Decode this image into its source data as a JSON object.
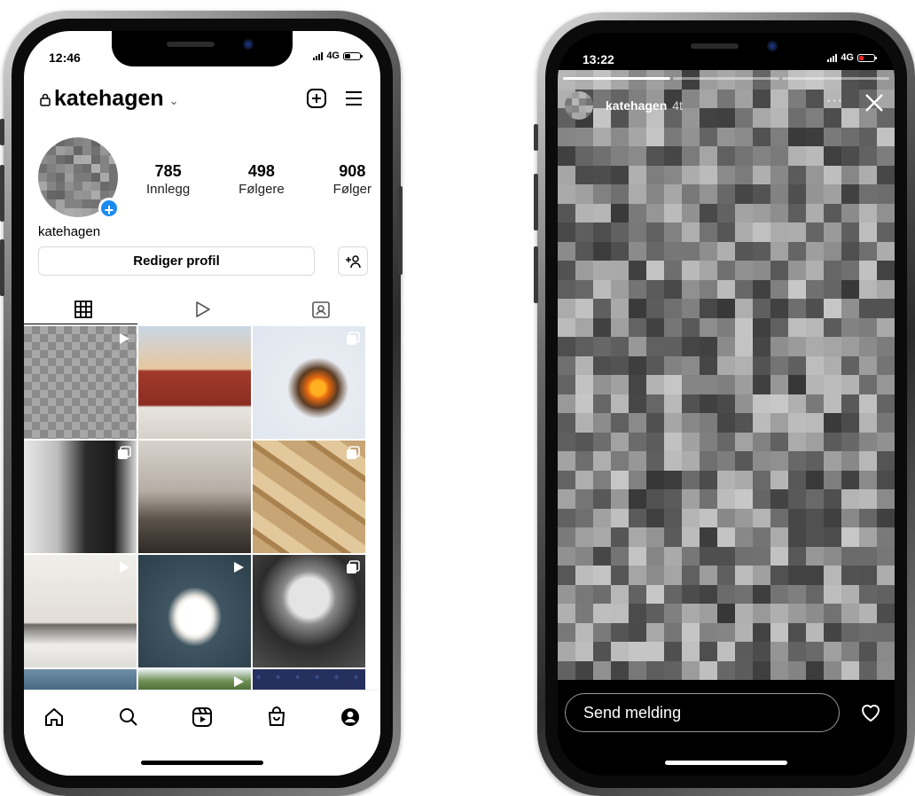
{
  "left_phone": {
    "status": {
      "time": "12:46",
      "network": "4G",
      "battery_color": "#000000"
    },
    "header": {
      "username": "katehagen",
      "lock_icon": "lock-icon",
      "chevron_icon": "chevron-down-icon",
      "chevron_glyph": "⌄",
      "new_post_icon": "plus-square-icon",
      "menu_icon": "hamburger-menu-icon"
    },
    "profile": {
      "stats": [
        {
          "number": "785",
          "label": "Innlegg"
        },
        {
          "number": "498",
          "label": "Følgere"
        },
        {
          "number": "908",
          "label": "Følger"
        }
      ],
      "display_name": "katehagen",
      "add_story_glyph": "+",
      "edit_button": "Rediger profil",
      "discover_people_icon": "add-user-icon"
    },
    "tabs": [
      {
        "icon": "grid-icon",
        "selected": true
      },
      {
        "icon": "reels-icon",
        "selected": false
      },
      {
        "icon": "tagged-icon",
        "selected": false
      }
    ],
    "grid": [
      {
        "desc": "blurred-image",
        "overlay": "reel-icon"
      },
      {
        "desc": "rooftop-sunset",
        "overlay": ""
      },
      {
        "desc": "campfire-in-snow",
        "overlay": "multi-icon"
      },
      {
        "desc": "person-in-snowy-forest",
        "overlay": "multi-icon"
      },
      {
        "desc": "dog-in-kitchen",
        "overlay": ""
      },
      {
        "desc": "cardboard-boxes",
        "overlay": "multi-icon"
      },
      {
        "desc": "snowy-building",
        "overlay": "reel-icon"
      },
      {
        "desc": "swan-on-water",
        "overlay": "reel-icon"
      },
      {
        "desc": "woman-with-glasses",
        "overlay": "multi-icon"
      },
      {
        "desc": "blue-sky",
        "overlay": ""
      },
      {
        "desc": "trees",
        "overlay": "reel-icon"
      },
      {
        "desc": "blueberries",
        "overlay": ""
      }
    ],
    "bottom_nav": [
      "home-icon",
      "search-icon",
      "reels-nav-icon",
      "shop-icon",
      "profile-icon"
    ]
  },
  "right_phone": {
    "status": {
      "time": "13:22",
      "network": "4G",
      "battery_color": "#e02424"
    },
    "story": {
      "username": "katehagen",
      "time_ago": "4t",
      "more_label": "···",
      "close_icon": "close-icon",
      "segments": 3,
      "active_segment": 0
    },
    "reply": {
      "placeholder": "Send melding",
      "like_icon": "heart-icon"
    }
  }
}
